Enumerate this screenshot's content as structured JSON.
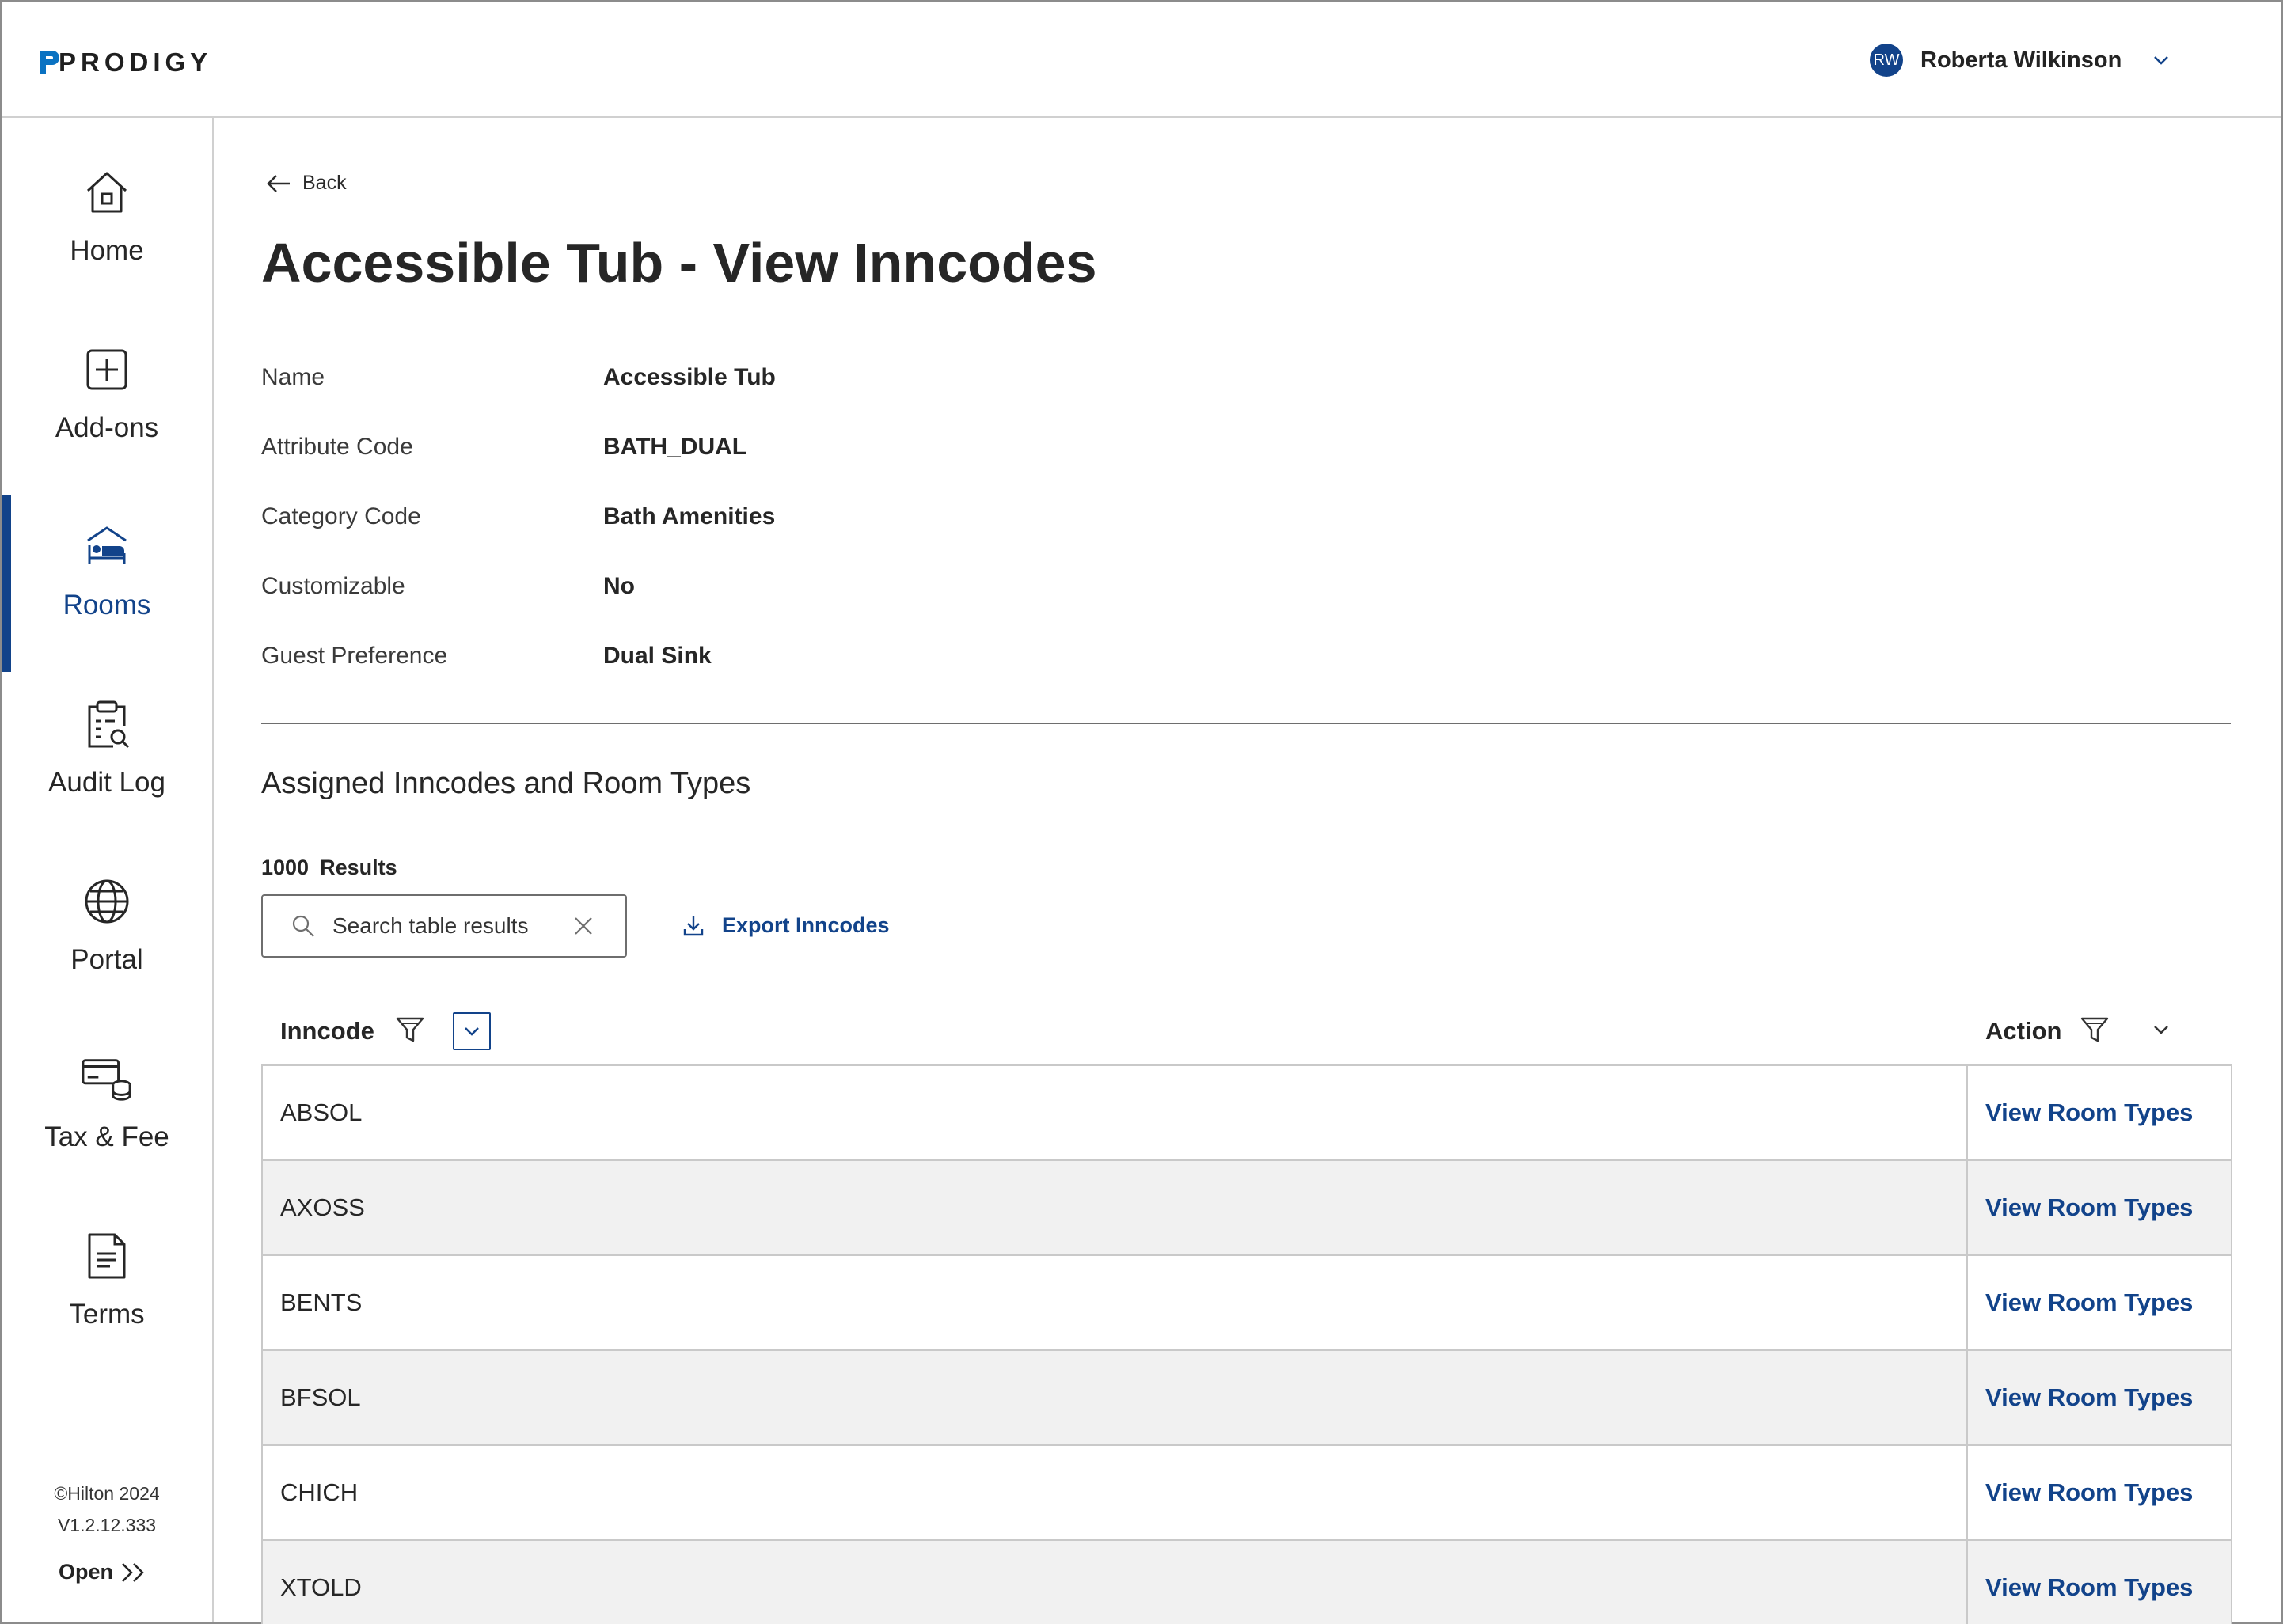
{
  "header": {
    "logo": "PRODIGY",
    "user": {
      "initials": "RW",
      "name": "Roberta Wilkinson"
    }
  },
  "sidebar": {
    "items": [
      {
        "label": "Home",
        "icon": "home-icon"
      },
      {
        "label": "Add-ons",
        "icon": "plus-square-icon"
      },
      {
        "label": "Rooms",
        "icon": "bed-icon",
        "active": true
      },
      {
        "label": "Audit Log",
        "icon": "clipboard-search-icon"
      },
      {
        "label": "Portal",
        "icon": "globe-icon"
      },
      {
        "label": "Tax & Fee",
        "icon": "card-coins-icon"
      },
      {
        "label": "Terms",
        "icon": "document-icon"
      }
    ],
    "copyright": "©Hilton 2024",
    "version": "V1.2.12.333",
    "open_label": "Open"
  },
  "main": {
    "back_label": "Back",
    "title": "Accessible Tub - View Inncodes",
    "details": [
      {
        "key": "Name",
        "value": "Accessible Tub"
      },
      {
        "key": "Attribute Code",
        "value": "BATH_DUAL"
      },
      {
        "key": "Category Code",
        "value": "Bath Amenities"
      },
      {
        "key": "Customizable",
        "value": "No"
      },
      {
        "key": "Guest Preference",
        "value": "Dual Sink"
      }
    ],
    "section_title": "Assigned Inncodes and Room Types",
    "results_count": "1000",
    "results_label": "Results",
    "search": {
      "placeholder": "Search table results"
    },
    "export_label": "Export Inncodes"
  },
  "table": {
    "columns": [
      "Inncode",
      "Action"
    ],
    "rows": [
      {
        "inncode": "ABSOL",
        "action": "View Room Types"
      },
      {
        "inncode": "AXOSS",
        "action": "View Room Types"
      },
      {
        "inncode": "BENTS",
        "action": "View Room Types"
      },
      {
        "inncode": "BFSOL",
        "action": "View Room Types"
      },
      {
        "inncode": "CHICH",
        "action": "View Room Types"
      },
      {
        "inncode": "XTOLD",
        "action": "View Room Types"
      }
    ]
  },
  "colors": {
    "accent": "#12438a",
    "logo_mark": "#0a72c2",
    "row_alt": "#f1f1f1"
  }
}
